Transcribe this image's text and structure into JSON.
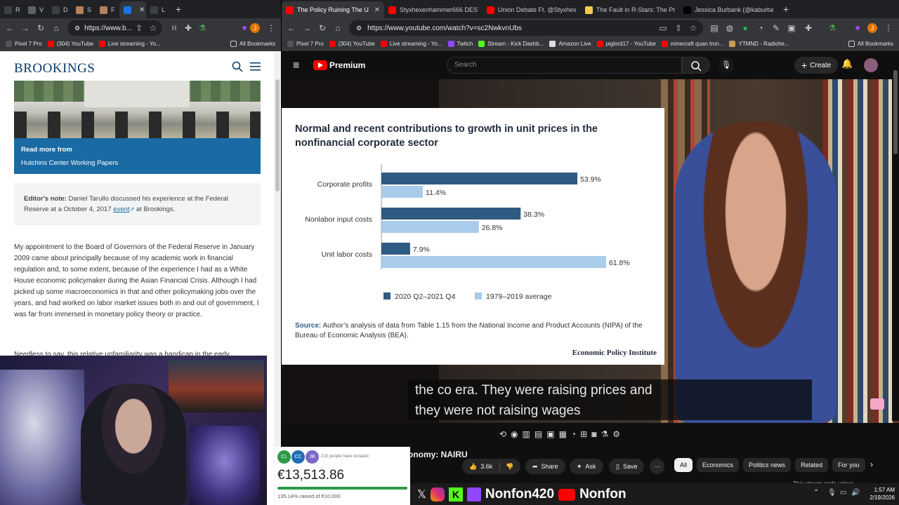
{
  "left_browser": {
    "tabs": [
      {
        "label": "R",
        "color": "#3c4043"
      },
      {
        "label": "V",
        "color": "#5f6368"
      },
      {
        "label": "D",
        "color": "#3c4043"
      },
      {
        "label": "S",
        "color": "#b5825a"
      },
      {
        "label": "F",
        "color": "#b5825a"
      },
      {
        "label": "I",
        "color": "#1a73e8",
        "active": true
      },
      {
        "label": "L",
        "color": "#3c4043"
      }
    ],
    "url": "https://www.b...",
    "bookmarks": [
      "Pixel 7 Pro",
      "(304) YouTube",
      "Live streaming - Yo...",
      "All Bookmarks"
    ]
  },
  "brookings": {
    "logo": "BROOKINGS",
    "read_more": "Read more from",
    "read_more_link": "Hutchins Center Working Papers",
    "editors_note_label": "Editor's note:",
    "editors_note_text": "Daniel Tarullo discussed his experience at the Federal Reserve at a October 4, 2017",
    "editors_note_link": "event",
    "editors_note_tail": "at Brookings.",
    "paragraph": "My appointment to the Board of Governors of the Federal Reserve in January 2009 came about principally because of my academic work in financial regulation and, to some extent, because of the experience I had as a White House economic policymaker during the Asian Financial Crisis.  Although I had picked up some macroeconomics in that and other policymaking jobs over the years, and had worked on labor market issues both in and out of government, I was far from immersed in monetary policy theory or practice.",
    "paragraph2_partial": "Needless to say, this relative unfamiliarity was a handicap in the early"
  },
  "right_browser": {
    "tabs": [
      {
        "label": "The Policy Ruining The U",
        "color": "#ff0000",
        "active": true
      },
      {
        "label": "Styxhexenhammer666 DESTR",
        "color": "#ff0000"
      },
      {
        "label": "Union Debate Ft. @Styxhexe",
        "color": "#ff0000"
      },
      {
        "label": "The Fault in R-Stars: The Prol",
        "color": "#f2c94c"
      },
      {
        "label": "Jessica Burbank (@kaburban)",
        "color": "#000000"
      }
    ],
    "url": "https://www.youtube.com/watch?v=sc2NwkvnUbs",
    "bookmarks": [
      "Pixel 7 Pro",
      "(304) YouTube",
      "Live streaming - Yo...",
      "Twitch",
      "Stream - Kick Dashb...",
      "Amazon Live",
      "piglord17 - YouTube",
      "minecraft quan tron...",
      "YTMND - Radiohe...",
      "All Bookmarks"
    ]
  },
  "youtube": {
    "brand": "Premium",
    "search_placeholder": "Search",
    "create_label": "Create",
    "caption_line1": "the co era. They were raising prices and",
    "caption_line2": "they were not raising wages",
    "title_partial": "onomy: NAIRU",
    "likes": "3.6k",
    "share_label": "Share",
    "ask_label": "Ask",
    "save_label": "Save",
    "chips": [
      "All",
      "Economics",
      "Politics news",
      "Related",
      "For you"
    ],
    "side_note": "This stream ends unless"
  },
  "donation": {
    "avatars": [
      {
        "initials": "CL",
        "color": "#2e9a48"
      },
      {
        "initials": "CC",
        "color": "#1f6fb5"
      },
      {
        "initials": "JB",
        "color": "#7b68c9"
      }
    ],
    "donors_text": "215 people have donated",
    "amount": "€13,513.86",
    "progress_fraction": 1.0,
    "raised_text": "135.14% raised of €10,000"
  },
  "overlay": {
    "handle1": "Nonfon420",
    "handle2": "Nonfon"
  },
  "taskbar": {
    "time": "1:57 AM",
    "date": "2/19/2026"
  },
  "chart_data": {
    "type": "bar",
    "orientation": "horizontal",
    "title": "Normal and recent contributions to growth in unit prices in the nonfinancial corporate sector",
    "categories": [
      "Corporate profits",
      "Nonlabor input costs",
      "Unit labor costs"
    ],
    "series": [
      {
        "name": "2020 Q2–2021 Q4",
        "color": "#2f5a82",
        "values": [
          53.9,
          38.3,
          7.9
        ],
        "labels": [
          "53.9%",
          "38.3%",
          "7.9%"
        ]
      },
      {
        "name": "1979–2019 average",
        "color": "#a9cbec",
        "values": [
          11.4,
          26.8,
          61.8
        ],
        "labels": [
          "11.4%",
          "26.8%",
          "61.8%"
        ]
      }
    ],
    "xlim": [
      0,
      62
    ],
    "source_label": "Source:",
    "source": "Author’s analysis of data from Table 1.15 from the National Income and Product Accounts (NIPA) of the Bureau of Economic Analysis (BEA).",
    "credit": "Economic Policy Institute",
    "legend": "bottom"
  }
}
